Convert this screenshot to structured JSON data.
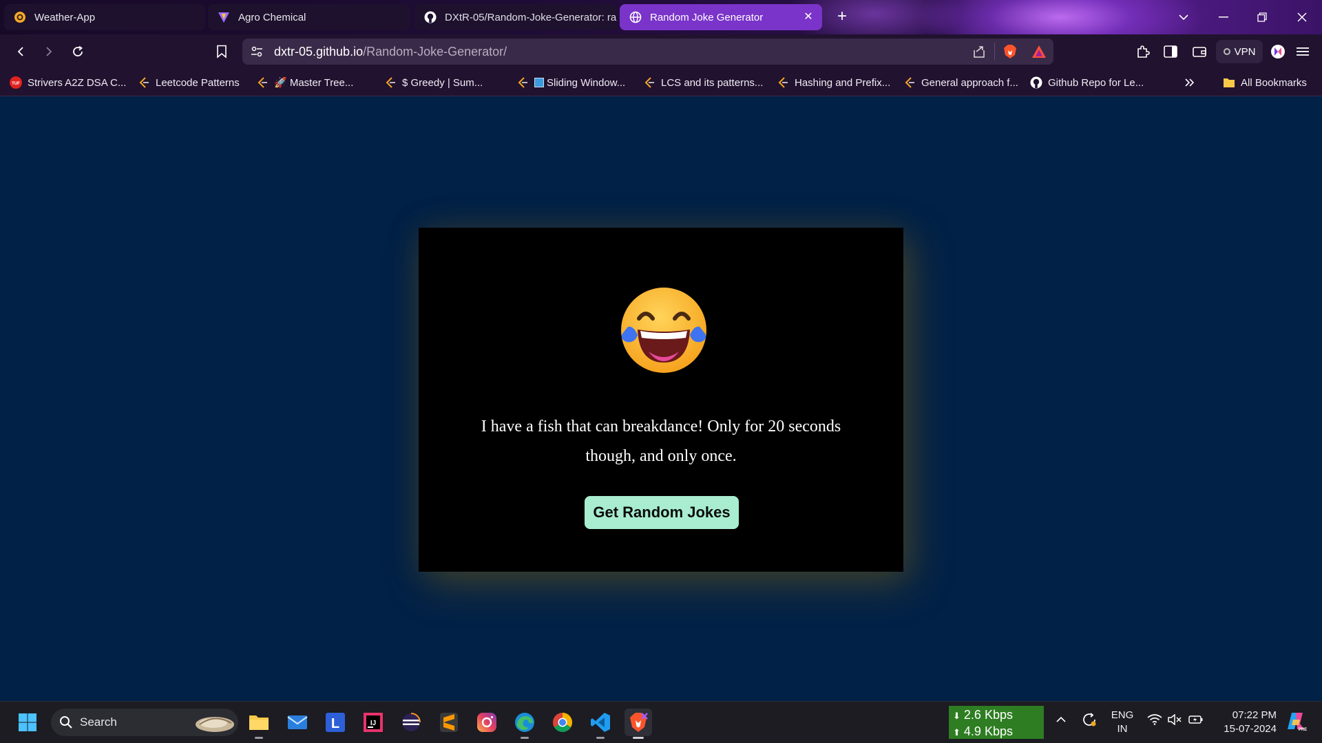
{
  "browser": {
    "tabs": [
      {
        "title": "Weather-App",
        "icon": "weather-app-icon"
      },
      {
        "title": "Agro Chemical",
        "icon": "vite-logo-icon"
      },
      {
        "title": "DXtR-05/Random-Joke-Generator: ra",
        "icon": "github-icon"
      },
      {
        "title": "Random Joke Generator",
        "icon": "globe-icon",
        "active": true
      }
    ],
    "address": {
      "host": "dxtr-05.github.io",
      "path": "/Random-Joke-Generator/"
    },
    "vpn_label": "VPN",
    "bookmarks": [
      {
        "label": "Strivers A2Z DSA C...",
        "icon": "tuf-icon"
      },
      {
        "label": "Leetcode Patterns",
        "icon": "leetcode-icon"
      },
      {
        "label": "🚀 Master Tree...",
        "icon": "leetcode-icon"
      },
      {
        "label": "$ Greedy | Sum...",
        "icon": "leetcode-icon"
      },
      {
        "label": "Sliding Window...",
        "icon": "leetcode-icon"
      },
      {
        "label": "LCS and its patterns...",
        "icon": "leetcode-icon"
      },
      {
        "label": "Hashing and Prefix...",
        "icon": "leetcode-icon"
      },
      {
        "label": "General approach f...",
        "icon": "leetcode-icon"
      },
      {
        "label": "Github Repo for Le...",
        "icon": "github-icon"
      }
    ],
    "all_bookmarks_label": "All Bookmarks"
  },
  "page": {
    "joke_text": "I have a fish that can breakdance! Only for 20 seconds though, and only once.",
    "button_label": "Get Random Jokes",
    "emoji": "face-with-tears-of-joy"
  },
  "taskbar": {
    "search_label": "Search",
    "net_down": "2.6 Kbps",
    "net_up": "4.9 Kbps",
    "lang_top": "ENG",
    "lang_bottom": "IN",
    "time": "07:22 PM",
    "date": "15-07-2024"
  },
  "colors": {
    "page_bg": "#022147",
    "card_bg": "#000000",
    "button_bg": "#a8edd0",
    "active_tab": "#7a34c9"
  }
}
